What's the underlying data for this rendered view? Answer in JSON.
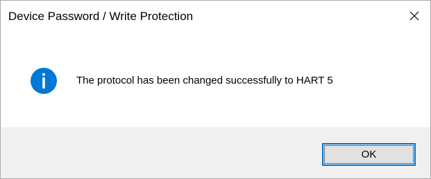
{
  "window": {
    "title": "Device Password / Write Protection",
    "close_icon": "close-icon"
  },
  "content": {
    "icon": "information-icon",
    "icon_color": "#0078d7",
    "message": "The protocol has been changed successfully to HART 5"
  },
  "footer": {
    "ok_label": "OK"
  }
}
